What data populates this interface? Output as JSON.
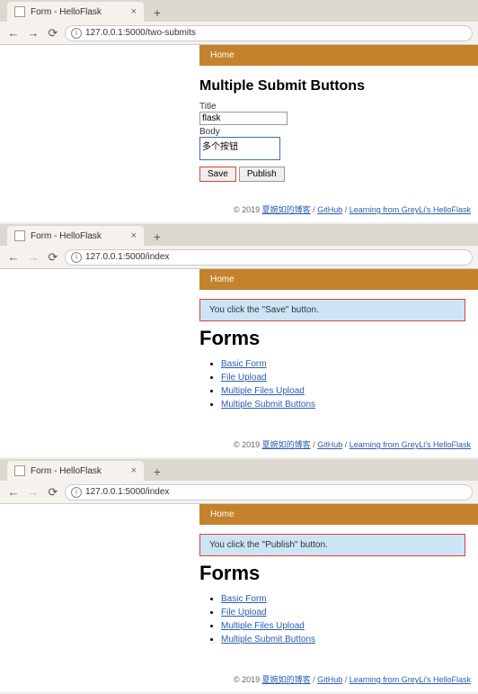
{
  "shared": {
    "tab_title": "Form - HelloFlask",
    "home_link": "Home",
    "footer_prefix": "© 2019 ",
    "footer_author": "夏婉如的博客",
    "footer_sep": " / ",
    "footer_github": "GitHub",
    "footer_learning": "Learning from GreyLi's HelloFlask"
  },
  "panel1": {
    "url": "127.0.0.1:5000/two-submits",
    "heading": "Multiple Submit Buttons",
    "title_label": "Title",
    "title_value": "flask",
    "body_label": "Body",
    "body_value": "多个按钮",
    "save_label": "Save",
    "publish_label": "Publish"
  },
  "panel2": {
    "url": "127.0.0.1:5000/index",
    "flash": "You click the \"Save\" button.",
    "heading": "Forms",
    "links": {
      "0": "Basic Form",
      "1": "File Upload",
      "2": "Multiple Files Upload",
      "3": "Multiple Submit Buttons"
    }
  },
  "panel3": {
    "url": "127.0.0.1:5000/index",
    "flash": "You click the \"Publish\" button.",
    "heading": "Forms",
    "links": {
      "0": "Basic Form",
      "1": "File Upload",
      "2": "Multiple Files Upload",
      "3": "Multiple Submit Buttons"
    }
  }
}
